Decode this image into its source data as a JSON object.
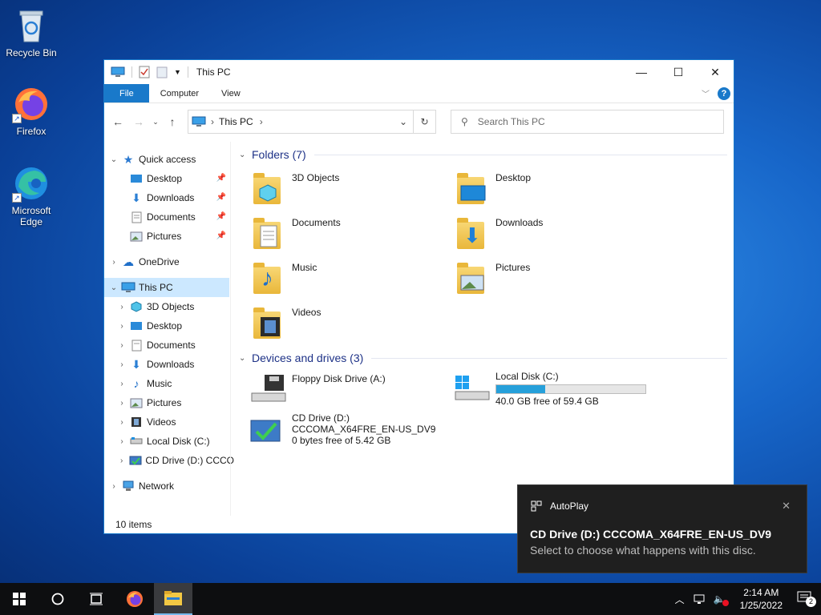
{
  "desktop": {
    "icons": [
      {
        "label": "Recycle Bin"
      },
      {
        "label": "Firefox"
      },
      {
        "label": "Microsoft Edge"
      }
    ]
  },
  "window": {
    "title": "This PC",
    "ribbon_tabs": [
      "File",
      "Computer",
      "View"
    ],
    "address": "This PC",
    "search_placeholder": "Search This PC",
    "status": "10 items"
  },
  "nav": {
    "quick_access": "Quick access",
    "quick_items": [
      "Desktop",
      "Downloads",
      "Documents",
      "Pictures"
    ],
    "onedrive": "OneDrive",
    "this_pc": "This PC",
    "pc_items": [
      "3D Objects",
      "Desktop",
      "Documents",
      "Downloads",
      "Music",
      "Pictures",
      "Videos",
      "Local Disk (C:)",
      "CD Drive (D:) CCCO"
    ],
    "network": "Network"
  },
  "content": {
    "folders_header": "Folders (7)",
    "folders": [
      "3D Objects",
      "Desktop",
      "Documents",
      "Downloads",
      "Music",
      "Pictures",
      "Videos"
    ],
    "devices_header": "Devices and drives (3)",
    "floppy": "Floppy Disk Drive (A:)",
    "local_disk": {
      "name": "Local Disk (C:)",
      "free": "40.0 GB free of 59.4 GB",
      "used_fraction": 0.33
    },
    "cd": {
      "name": "CD Drive (D:)",
      "label": "CCCOMA_X64FRE_EN-US_DV9",
      "free": "0 bytes free of 5.42 GB"
    }
  },
  "toast": {
    "app": "AutoPlay",
    "title": "CD Drive (D:) CCCOMA_X64FRE_EN-US_DV9",
    "body": "Select to choose what happens with this disc."
  },
  "taskbar": {
    "time": "2:14 AM",
    "date": "1/25/2022",
    "notification_count": "2"
  },
  "colors": {
    "accent": "#1979ca",
    "selection": "#cce8ff",
    "header_blue": "#1e3287"
  }
}
